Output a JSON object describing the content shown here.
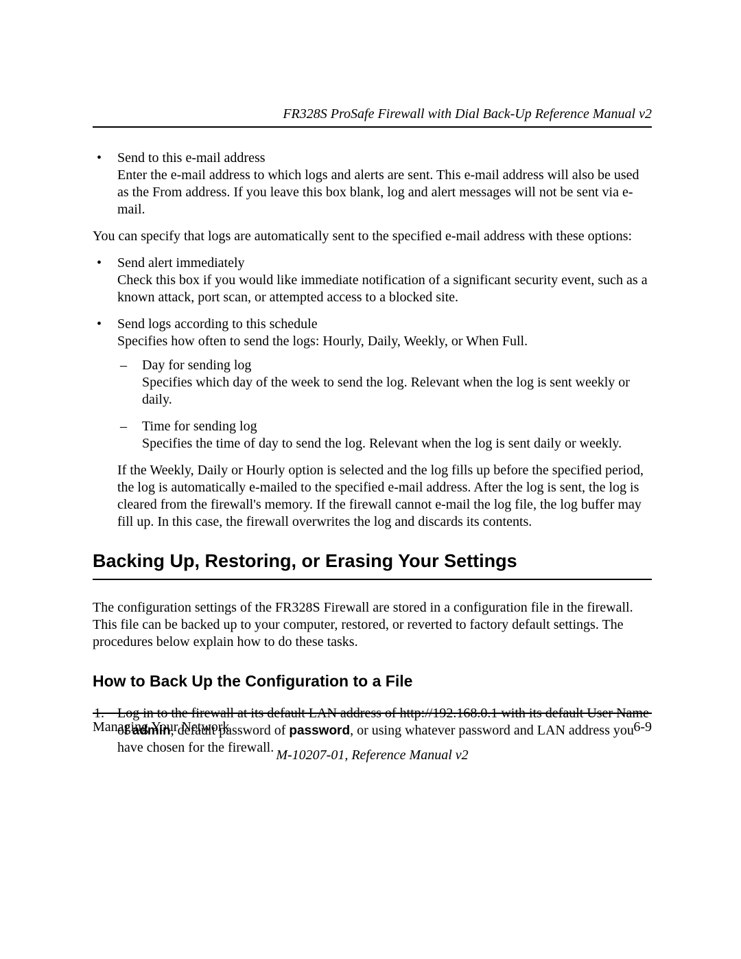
{
  "header": {
    "running_title": "FR328S ProSafe Firewall with Dial Back-Up Reference Manual v2"
  },
  "bullets_top": [
    {
      "title": "Send to this e-mail address",
      "desc": "Enter the e-mail address to which logs and alerts are sent. This e-mail address will also be used as the From address. If you leave this box blank, log and alert messages will not be sent via e-mail."
    }
  ],
  "intro_para": "You can specify that logs are automatically sent to the specified e-mail address with these options:",
  "bullets_options": [
    {
      "title": "Send alert immediately",
      "desc": "Check this box if you would like immediate notification of a significant security event, such as a known attack, port scan, or attempted access to a blocked site."
    },
    {
      "title": "Send logs according to this schedule",
      "desc": "Specifies how often to send the logs: Hourly, Daily, Weekly, or When Full.",
      "sub": [
        {
          "title": "Day for sending log",
          "desc": "Specifies which day of the week to send the log. Relevant when the log is sent weekly or daily."
        },
        {
          "title": "Time for sending log",
          "desc": "Specifies the time of day to send the log. Relevant when the log is sent daily or weekly."
        }
      ],
      "trailing": "If the Weekly, Daily or Hourly option is selected and the log fills up before the specified period, the log is automatically e-mailed to the specified e-mail address. After the log is sent, the log is cleared from the firewall's memory. If the firewall cannot e-mail the log file, the log buffer may fill up. In this case, the firewall overwrites the log and discards its contents."
    }
  ],
  "section_heading": "Backing Up, Restoring, or Erasing Your Settings",
  "section_intro": "The configuration settings of the FR328S Firewall  are stored in a configuration file in the firewall. This file can be backed up to your computer, restored, or reverted to factory default settings. The procedures below explain how to do these tasks.",
  "subsection_heading": "How to Back Up the Configuration to a File",
  "steps": [
    {
      "num": "1.",
      "pre": "Log in to the firewall at its default LAN address of http://192.168.0.1 with its default User Name of ",
      "bold1": "admin",
      "mid": ", default password of ",
      "bold2": "password",
      "post": ", or using whatever password and LAN address you have chosen for the firewall."
    }
  ],
  "footer": {
    "left": "Managing Your Network",
    "right": "6-9",
    "center": "M-10207-01, Reference Manual v2"
  }
}
